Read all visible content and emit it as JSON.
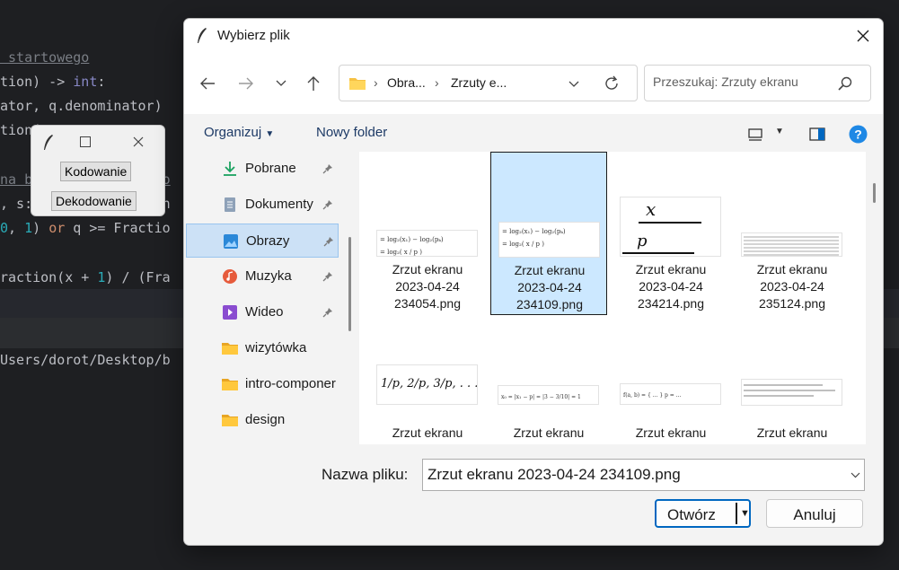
{
  "editor": {
    "lines": [
      {
        "parts": [
          {
            "t": " startowego",
            "c": "comment"
          }
        ]
      },
      {
        "parts": [
          {
            "t": "tion) -> ",
            "c": ""
          },
          {
            "t": "int",
            "c": "typ"
          },
          {
            "t": ":",
            "c": ""
          }
        ]
      },
      {
        "parts": [
          {
            "t": "ator, q.denominator)",
            "c": ""
          }
        ]
      },
      {
        "parts": [
          {
            "t": "tion(",
            "c": ""
          }
        ]
      },
      {
        "parts": [
          {
            "t": "",
            "c": ""
          }
        ]
      },
      {
        "parts": [
          {
            "t": "na b",
            "c": "comment"
          },
          {
            "t": "               ko",
            "c": "comment"
          }
        ]
      },
      {
        "parts": [
          {
            "t": ", s:",
            "c": ""
          },
          {
            "t": "               in",
            "c": ""
          }
        ]
      },
      {
        "parts": [
          {
            "t": "0",
            "c": "num"
          },
          {
            "t": ", ",
            "c": ""
          },
          {
            "t": "1",
            "c": "num"
          },
          {
            "t": ") ",
            "c": ""
          },
          {
            "t": "or",
            "c": "kw"
          },
          {
            "t": " q >= Fractio",
            "c": ""
          }
        ]
      },
      {
        "parts": [
          {
            "t": "",
            "c": ""
          }
        ]
      },
      {
        "parts": [
          {
            "t": "raction(x + ",
            "c": ""
          },
          {
            "t": "1",
            "c": "num"
          },
          {
            "t": ") / (Fra",
            "c": ""
          }
        ]
      }
    ],
    "path": "Users/dorot/Desktop/b"
  },
  "tk_window": {
    "btn_encode": "Kodowanie",
    "btn_decode": "Dekodowanie"
  },
  "dialog": {
    "title": "Wybierz plik",
    "breadcrumb": [
      "Obra...",
      "Zrzuty e..."
    ],
    "search_placeholder": "Przeszukaj: Zrzuty ekranu",
    "organize": "Organizuj",
    "new_folder": "Nowy folder",
    "nav_items": [
      {
        "label": "Pobrane",
        "icon": "download-icon",
        "pinned": true
      },
      {
        "label": "Dokumenty",
        "icon": "document-icon",
        "pinned": true
      },
      {
        "label": "Obrazy",
        "icon": "pictures-icon",
        "pinned": true,
        "selected": true
      },
      {
        "label": "Muzyka",
        "icon": "music-icon",
        "pinned": true
      },
      {
        "label": "Wideo",
        "icon": "video-icon",
        "pinned": true
      },
      {
        "label": "wizytówka",
        "icon": "folder-icon",
        "pinned": false
      },
      {
        "label": "intro-componer",
        "icon": "folder-icon",
        "pinned": false
      },
      {
        "label": "design",
        "icon": "folder-icon",
        "pinned": false
      }
    ],
    "files": [
      {
        "line1": "Zrzut ekranu",
        "line2": "2023-04-24",
        "line3": "234054.png"
      },
      {
        "line1": "Zrzut ekranu",
        "line2": "2023-04-24",
        "line3": "234109.png",
        "selected": true
      },
      {
        "line1": "Zrzut ekranu",
        "line2": "2023-04-24",
        "line3": "234214.png"
      },
      {
        "line1": "Zrzut ekranu",
        "line2": "2023-04-24",
        "line3": "235124.png"
      },
      {
        "line1": "Zrzut ekranu"
      },
      {
        "line1": "Zrzut ekranu"
      },
      {
        "line1": "Zrzut ekranu"
      },
      {
        "line1": "Zrzut ekranu"
      }
    ],
    "filename_label": "Nazwa pliku:",
    "filename_value": "Zrzut ekranu 2023-04-24 234109.png",
    "open_button": "Otwórz",
    "cancel_button": "Anuluj"
  },
  "colors": {
    "accent": "#0067c0",
    "selection": "#cce8ff",
    "nav_selection": "#cce1f6"
  }
}
